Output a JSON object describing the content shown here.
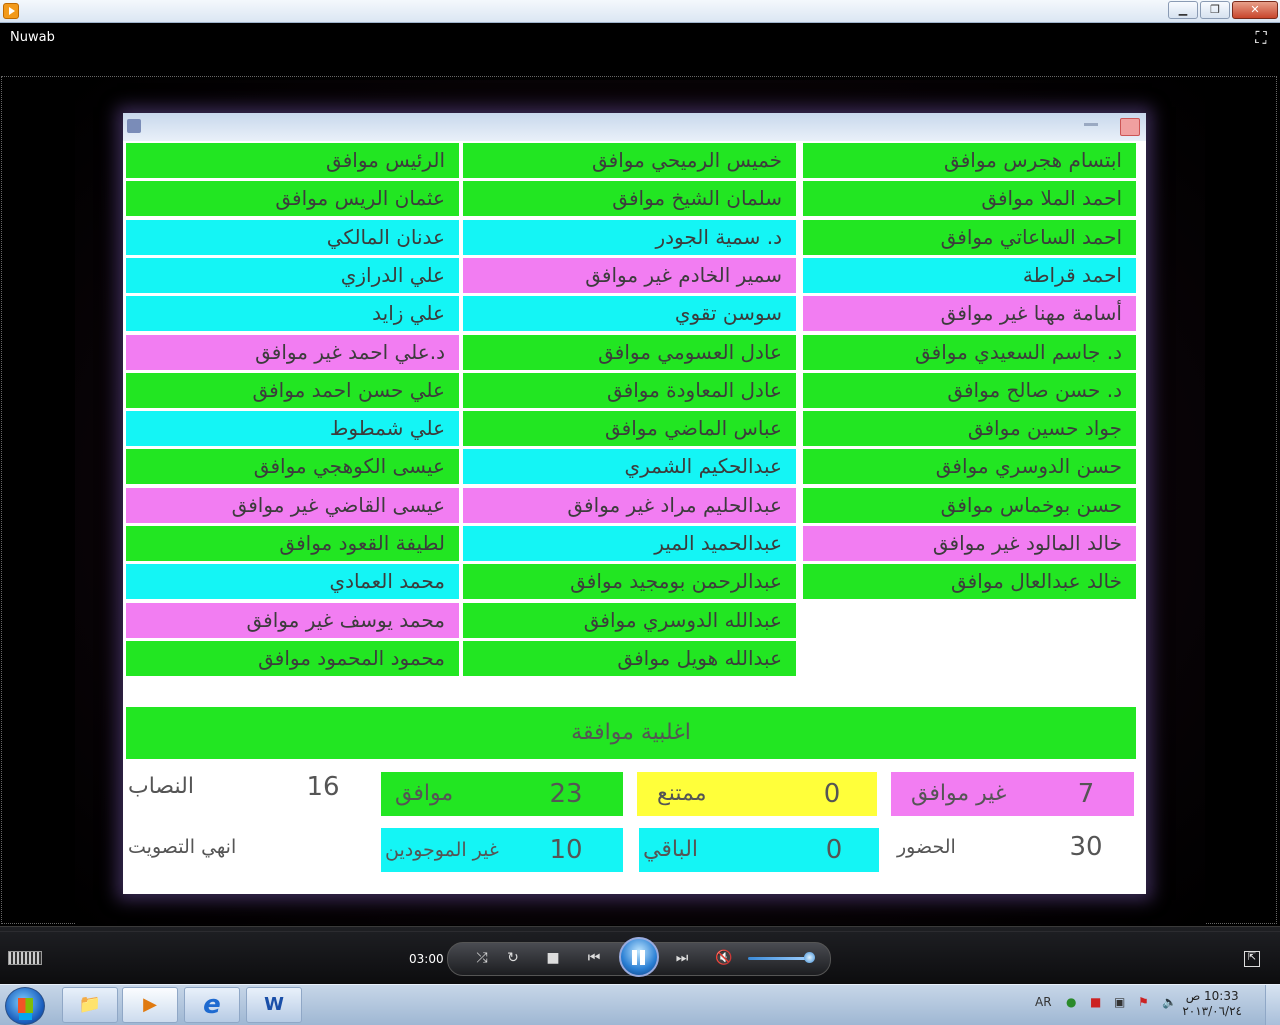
{
  "window": {
    "title": "Nuwab",
    "controls": {
      "minimize": "▁",
      "maximize": "❐",
      "close": "✕"
    }
  },
  "colors": {
    "agree": "#22e622",
    "absent": "#14f5f5",
    "disagree": "#f27df2",
    "abstain": "#ffff3a"
  },
  "video": {
    "title": "",
    "columns": [
      {
        "id": "right",
        "rows": [
          {
            "text": "ابتسام هجرس موافق",
            "status": "green"
          },
          {
            "text": "احمد الملا موافق",
            "status": "green"
          },
          {
            "text": "احمد الساعاتي موافق",
            "status": "green"
          },
          {
            "text": "احمد قراطة",
            "status": "cyan"
          },
          {
            "text": "أسامة مهنا غير موافق",
            "status": "magenta"
          },
          {
            "text": "د. جاسم السعيدي موافق",
            "status": "green"
          },
          {
            "text": "د. حسن صالح موافق",
            "status": "green"
          },
          {
            "text": "جواد حسين موافق",
            "status": "green"
          },
          {
            "text": "حسن الدوسري موافق",
            "status": "green"
          },
          {
            "text": "حسن بوخماس موافق",
            "status": "green"
          },
          {
            "text": "خالد المالود غير موافق",
            "status": "magenta"
          },
          {
            "text": "خالد عبدالعال موافق",
            "status": "green"
          }
        ]
      },
      {
        "id": "middle",
        "rows": [
          {
            "text": "خميس الرميحي موافق",
            "status": "green"
          },
          {
            "text": "سلمان الشيخ موافق",
            "status": "green"
          },
          {
            "text": "د. سمية الجودر",
            "status": "cyan"
          },
          {
            "text": "سمير الخادم غير موافق",
            "status": "magenta"
          },
          {
            "text": "سوسن تقوي",
            "status": "cyan"
          },
          {
            "text": "عادل العسومي موافق",
            "status": "green"
          },
          {
            "text": "عادل المعاودة موافق",
            "status": "green"
          },
          {
            "text": "عباس الماضي موافق",
            "status": "green"
          },
          {
            "text": "عبدالحكيم الشمري",
            "status": "cyan"
          },
          {
            "text": "عبدالحليم مراد غير موافق",
            "status": "magenta"
          },
          {
            "text": "عبدالحميد المير",
            "status": "cyan"
          },
          {
            "text": "عبدالرحمن بومجيد موافق",
            "status": "green"
          },
          {
            "text": "عبدالله الدوسري موافق",
            "status": "green"
          },
          {
            "text": "عبدالله هويل موافق",
            "status": "green"
          }
        ]
      },
      {
        "id": "left",
        "rows": [
          {
            "text": "الرئيس موافق",
            "status": "green"
          },
          {
            "text": "عثمان الريس موافق",
            "status": "green"
          },
          {
            "text": "عدنان المالكي",
            "status": "cyan"
          },
          {
            "text": "علي الدرازي",
            "status": "cyan"
          },
          {
            "text": "علي زايد",
            "status": "cyan"
          },
          {
            "text": "د.علي احمد غير موافق",
            "status": "magenta"
          },
          {
            "text": "علي حسن احمد موافق",
            "status": "green"
          },
          {
            "text": "علي شمطوط",
            "status": "cyan"
          },
          {
            "text": "عيسى الكوهجي موافق",
            "status": "green"
          },
          {
            "text": "عيسى القاضي غير موافق",
            "status": "magenta"
          },
          {
            "text": "لطيفة القعود موافق",
            "status": "green"
          },
          {
            "text": "محمد العمادي",
            "status": "cyan"
          },
          {
            "text": "محمد يوسف غير موافق",
            "status": "magenta"
          },
          {
            "text": "محمود المحمود موافق",
            "status": "green"
          }
        ]
      }
    ],
    "verdict": "اغلبية موافقة",
    "stats": {
      "quorum": {
        "label": "النصاب",
        "value": "16"
      },
      "agree": {
        "label": "موافق",
        "value": "23"
      },
      "abstain": {
        "label": "ممتنع",
        "value": "0"
      },
      "disagree": {
        "label": "غير موافق",
        "value": "7"
      },
      "end_vote": {
        "label": "انهي التصويت"
      },
      "not_present": {
        "label": "غير الموجودين",
        "value": "10"
      },
      "remaining": {
        "label": "الباقي",
        "value": "0"
      },
      "present": {
        "label": "الحضور",
        "value": "30"
      }
    }
  },
  "player": {
    "time": "03:00",
    "buttons": {
      "shuffle": "⤮",
      "repeat": "↻",
      "stop": "■",
      "prev": "⏮",
      "next": "⏭",
      "mute": "🔇",
      "switch_view": "⇱"
    },
    "volume_level": 0.9,
    "playing": true
  },
  "taskbar": {
    "language": "AR",
    "clock_time": "10:33 ص",
    "clock_date": "٢٠١٣/٠٦/٢٤",
    "apps": [
      "explorer",
      "media-player",
      "internet-explorer",
      "word"
    ],
    "word_glyph": "W",
    "ie_glyph": "e"
  }
}
